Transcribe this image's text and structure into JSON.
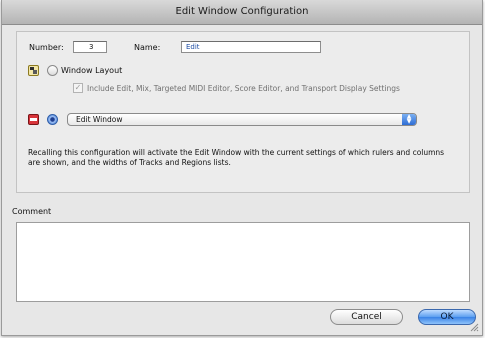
{
  "window": {
    "title": "Edit Window Configuration"
  },
  "form": {
    "number_label": "Number:",
    "number_value": "3",
    "name_label": "Name:",
    "name_value": "Edit"
  },
  "window_layout": {
    "label": "Window Layout",
    "selected": false,
    "include_checkbox_label": "Include Edit, Mix, Targeted MIDI Editor, Score Editor, and Transport Display Settings",
    "include_checked": true,
    "include_enabled": false,
    "icon": "window-layout-icon"
  },
  "window_selector": {
    "selected": true,
    "value": "Edit Window",
    "icon": "edit-window-icon"
  },
  "description": "Recalling this configuration will activate the Edit Window with the current settings of which rulers and columns are shown, and the widths of Tracks and Regions lists.",
  "comment": {
    "label": "Comment",
    "value": ""
  },
  "buttons": {
    "cancel": "Cancel",
    "ok": "OK"
  },
  "colors": {
    "accent": "#3a82e6",
    "name_text": "#1f4ea5",
    "window_bg": "#e7e7e7"
  }
}
